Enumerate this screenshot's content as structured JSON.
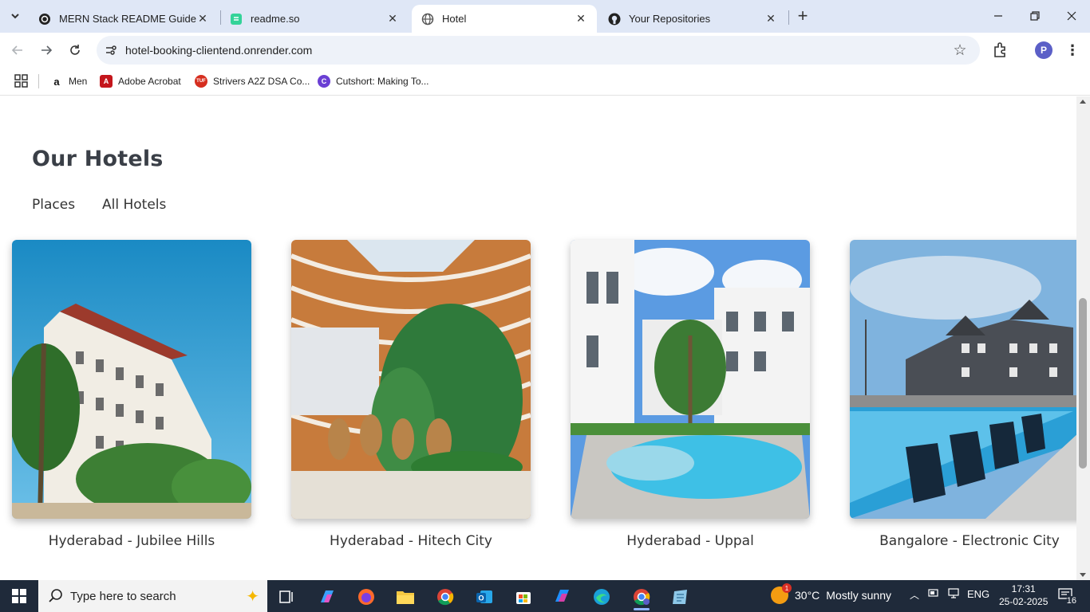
{
  "browser": {
    "tabs": [
      {
        "title": "MERN Stack README Guide"
      },
      {
        "title": "readme.so"
      },
      {
        "title": "Hotel"
      },
      {
        "title": "Your Repositories"
      }
    ],
    "url": "hotel-booking-clientend.onrender.com",
    "profile_initial": "P"
  },
  "bookmarks": [
    {
      "label": "Men"
    },
    {
      "label": "Adobe Acrobat"
    },
    {
      "label": "Strivers A2Z DSA Co..."
    },
    {
      "label": "Cutshort: Making To..."
    }
  ],
  "page": {
    "section_title": "Our Hotels",
    "filters": [
      "Places",
      "All Hotels"
    ],
    "hotels": [
      {
        "name": "Hyderabad - Jubilee Hills"
      },
      {
        "name": "Hyderabad - Hitech City"
      },
      {
        "name": "Hyderabad - Uppal"
      },
      {
        "name": "Bangalore - Electronic City"
      }
    ]
  },
  "taskbar": {
    "search_placeholder": "Type here to search",
    "weather_temp": "30°C",
    "weather_desc": "Mostly sunny",
    "weather_badge": "1",
    "language": "ENG",
    "time": "17:31",
    "date": "25-02-2025",
    "notifications": "16"
  },
  "colors": {
    "tabstrip": "#dfe7f6",
    "omnibox": "#eef2f9",
    "taskbar": "#1f2a3a",
    "heading": "#3a3f47"
  }
}
